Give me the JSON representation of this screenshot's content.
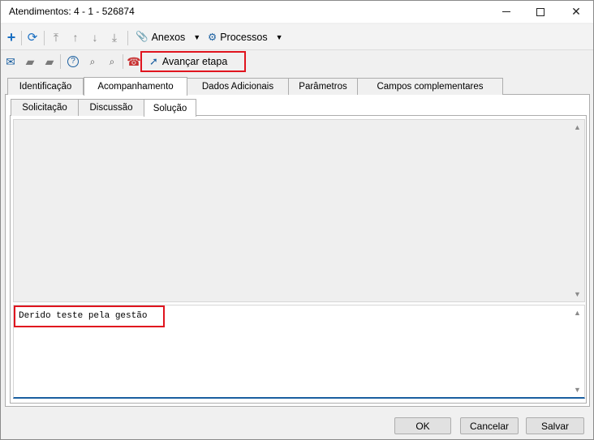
{
  "window": {
    "title": "Atendimentos: 4 - 1 - 526874"
  },
  "toolbar": {
    "icons": [
      "add-icon",
      "refresh-icon",
      "move-top-icon",
      "move-up-icon",
      "move-down-icon",
      "move-bottom-icon"
    ],
    "anexos_label": "Anexos",
    "processos_label": "Processos"
  },
  "toolbar2": {
    "advance_label": "Avançar etapa"
  },
  "tabs": [
    {
      "label": "Identificação"
    },
    {
      "label": "Acompanhamento"
    },
    {
      "label": "Dados Adicionais"
    },
    {
      "label": "Parâmetros"
    },
    {
      "label": "Campos complementares"
    }
  ],
  "subtabs": [
    {
      "label": "Solicitação"
    },
    {
      "label": "Discussão"
    },
    {
      "label": "Solução"
    }
  ],
  "editor": {
    "text": "Derido teste pela gestão"
  },
  "buttons": {
    "ok": "OK",
    "cancel": "Cancelar",
    "save": "Salvar"
  },
  "colors": {
    "highlight": "#e0141e",
    "accent": "#1a5fa0"
  }
}
